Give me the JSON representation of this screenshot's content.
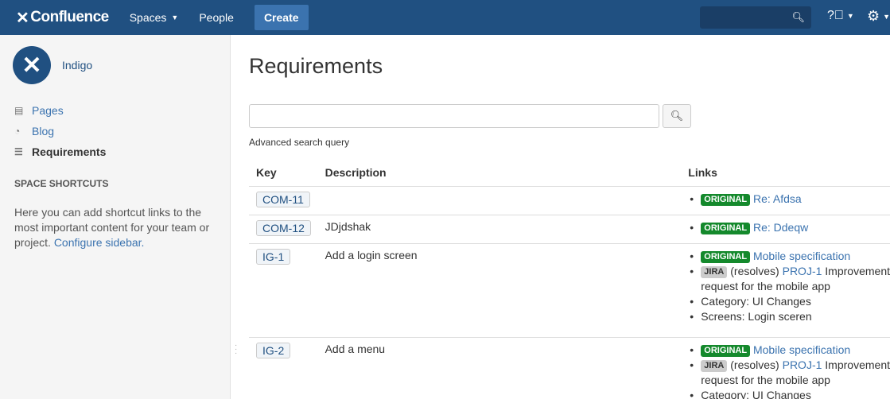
{
  "topnav": {
    "logo": "Confluence",
    "spaces": "Spaces",
    "people": "People",
    "create": "Create",
    "search_placeholder": ""
  },
  "sidebar": {
    "space_name": "Indigo",
    "items": [
      {
        "label": "Pages"
      },
      {
        "label": "Blog"
      },
      {
        "label": "Requirements"
      }
    ],
    "shortcuts_title": "SPACE SHORTCUTS",
    "shortcuts_text": "Here you can add shortcut links to the most important content for your team or project.",
    "configure_link": "Configure sidebar."
  },
  "main": {
    "title": "Requirements",
    "search_value": "",
    "advanced_link": "Advanced search query",
    "columns": [
      "Key",
      "Description",
      "Links"
    ],
    "rows": [
      {
        "key": "COM-11",
        "description": "",
        "orig": "ORIGINAL",
        "orig_link": "Re: Afdsa"
      },
      {
        "key": "COM-12",
        "description": "JDjdshak",
        "orig": "ORIGINAL",
        "orig_link": "Re: Ddeqw"
      },
      {
        "key": "IG-1",
        "description": "Add a login screen",
        "orig": "ORIGINAL",
        "orig_link": "Mobile specification",
        "jira": "JIRA",
        "jira_rel": "(resolves)",
        "jira_link": "PROJ-1",
        "jira_text": "Improvement",
        "jira_cont": "request for the mobile app",
        "category": "Category: UI Changes",
        "screens": "Screens: Login sceren"
      },
      {
        "key": "IG-2",
        "description": "Add a menu",
        "orig": "ORIGINAL",
        "orig_link": "Mobile specification",
        "jira": "JIRA",
        "jira_rel": "(resolves)",
        "jira_link": "PROJ-1",
        "jira_text": "Improvement",
        "jira_cont": "request for the mobile app",
        "category": "Category: UI Changes"
      }
    ]
  }
}
